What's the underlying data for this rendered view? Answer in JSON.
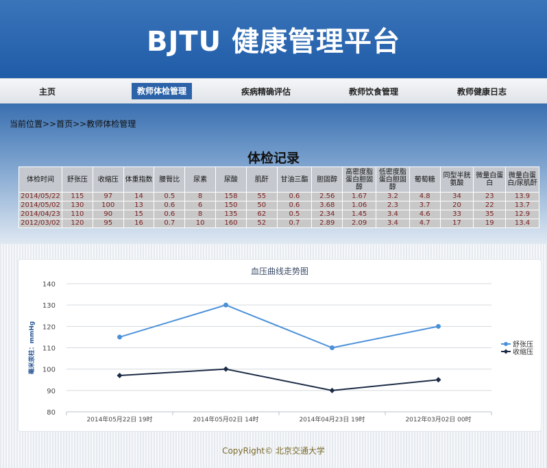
{
  "header": {
    "title": "BJTU 健康管理平台"
  },
  "nav": {
    "items": [
      "主页",
      "教师体检管理",
      "疾病精确评估",
      "教师饮食管理",
      "教师健康日志"
    ],
    "active_index": 1
  },
  "breadcrumb": "当前位置>>首页>>教师体检管理",
  "records": {
    "title": "体检记录",
    "columns": [
      "体检时间",
      "舒张压",
      "收缩压",
      "体重指数",
      "腰臀比",
      "尿素",
      "尿酸",
      "肌酐",
      "甘油三酯",
      "胆固醇",
      "高密度脂蛋白胆固醇",
      "低密度脂蛋白胆固醇",
      "葡萄糖",
      "同型半胱氨酸",
      "微量白蛋白",
      "微量白蛋白/尿肌酐"
    ],
    "rows": [
      [
        "2014/05/22",
        "115",
        "97",
        "14",
        "0.5",
        "8",
        "158",
        "55",
        "0.6",
        "2.56",
        "1.67",
        "3.2",
        "4.8",
        "34",
        "23",
        "13.9"
      ],
      [
        "2014/05/02",
        "130",
        "100",
        "13",
        "0.6",
        "6",
        "150",
        "50",
        "0.6",
        "3.68",
        "1.06",
        "2.3",
        "3.7",
        "20",
        "22",
        "13.7"
      ],
      [
        "2014/04/23",
        "110",
        "90",
        "15",
        "0.6",
        "8",
        "135",
        "62",
        "0.5",
        "2.34",
        "1.45",
        "3.4",
        "4.6",
        "33",
        "35",
        "12.9"
      ],
      [
        "2012/03/02",
        "120",
        "95",
        "16",
        "0.7",
        "10",
        "160",
        "52",
        "0.7",
        "2.89",
        "2.09",
        "3.4",
        "4.7",
        "17",
        "19",
        "13.4"
      ]
    ]
  },
  "chart_data": {
    "type": "line",
    "title": "血压曲线走势图",
    "ylabel": "毫米汞柱：mmHg",
    "xlabel": "",
    "categories": [
      "2014年05月22日 19时",
      "2014年05月02日 14时",
      "2014年04月23日 19时",
      "2012年03月02日 00时"
    ],
    "ylim": [
      80,
      140
    ],
    "yticks": [
      80,
      90,
      100,
      110,
      120,
      130,
      140
    ],
    "grid": true,
    "legend": "right",
    "series": [
      {
        "name": "舒张压",
        "values": [
          115,
          130,
          110,
          120
        ],
        "color": "#4a90d9"
      },
      {
        "name": "收缩压",
        "values": [
          97,
          100,
          90,
          95
        ],
        "color": "#1c2b45"
      }
    ]
  },
  "footer": {
    "text": "CopyRight© 北京交通大学"
  }
}
